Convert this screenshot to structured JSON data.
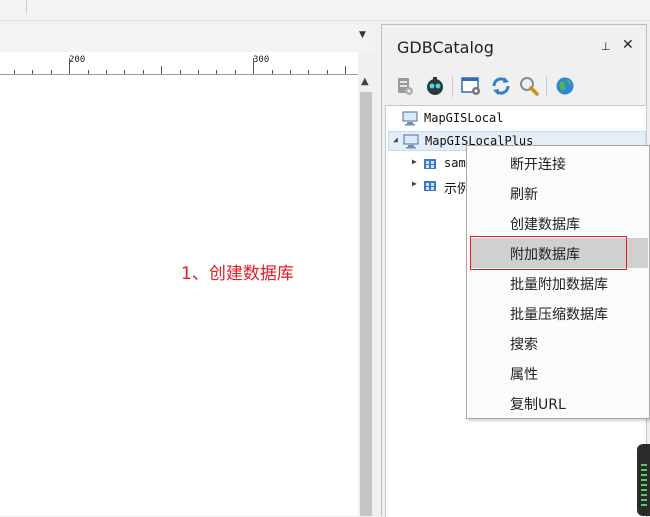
{
  "document": {
    "ruler_labels": [
      "200",
      "300"
    ],
    "annotation": "1、创建数据库"
  },
  "catalog": {
    "title": "GDBCatalog",
    "pin_icon": "pin-icon",
    "close_icon": "close-icon",
    "toolbar_icons": [
      "database-settings-icon",
      "gear-robot-icon",
      "window-settings-icon",
      "refresh-icon",
      "search-icon",
      "globe-icon"
    ],
    "tree": [
      {
        "label": "MapGISLocal",
        "level": 0,
        "expanded": null
      },
      {
        "label": "MapGISLocalPlus",
        "level": 0,
        "expanded": true,
        "selected": true
      },
      {
        "label": "sam",
        "level": 1,
        "expanded": false
      },
      {
        "label": "示例",
        "level": 1,
        "expanded": false
      }
    ]
  },
  "context_menu": {
    "items": [
      "断开连接",
      "刷新",
      "创建数据库",
      "附加数据库",
      "批量附加数据库",
      "批量压缩数据库",
      "搜索",
      "属性",
      "复制URL"
    ],
    "hovered_index": 3
  },
  "colors": {
    "annotation": "#e31b23",
    "menu_hover": "#d0d0d0",
    "tree_selected": "#e3eef9"
  }
}
